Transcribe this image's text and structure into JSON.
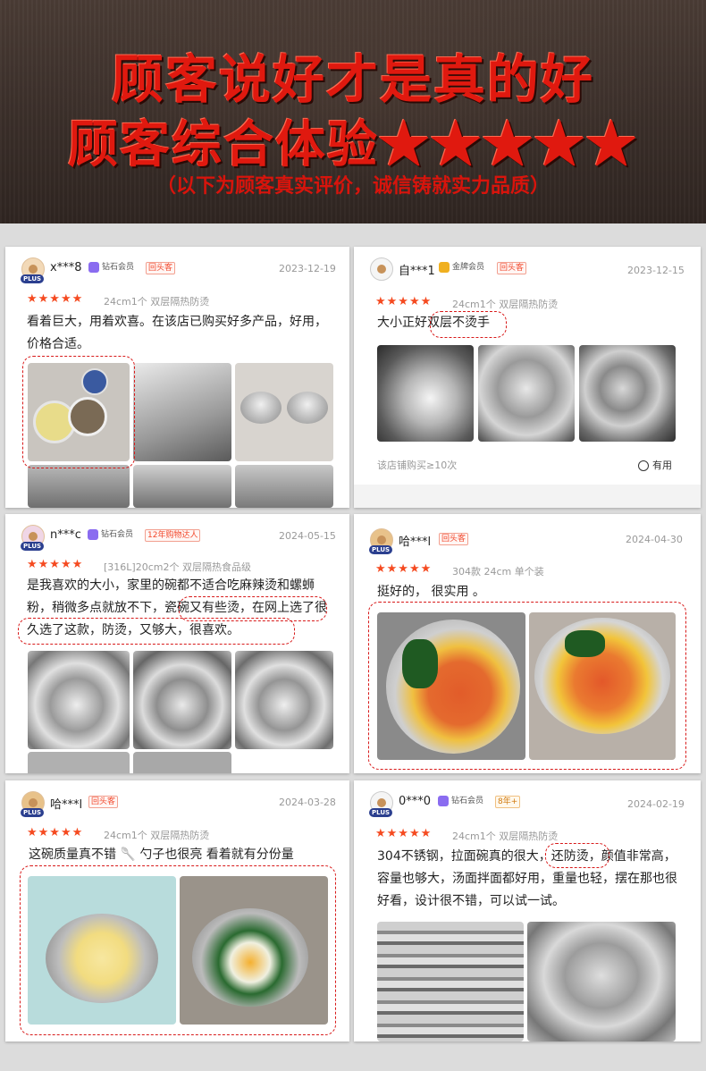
{
  "banner": {
    "line1": "顾客说好才是真的好",
    "line2": "顾客综合体验",
    "stars": "★★★★★",
    "subtitle": "（以下为顾客真实评价，诚信铸就实力品质）"
  },
  "reviews": [
    {
      "user": "x***8",
      "badge": "钻石会员",
      "tag": "回头客",
      "date": "2023-12-19",
      "rating": "★★★★★",
      "spec": "24cm1个 双层隔热防烫",
      "text": "看着巨大，用着欢喜。在该店已购买好多产品，好用，价格合适。",
      "plus": "PLUS"
    },
    {
      "user": "自***1",
      "badge": "金牌会员",
      "tag": "回头客",
      "date": "2023-12-15",
      "rating": "★★★★★",
      "spec": "24cm1个 双层隔热防烫",
      "text": "大小正好双层不烫手",
      "footer": "该店铺购买≥10次",
      "useful": "有用"
    },
    {
      "user": "n***c",
      "badge": "钻石会员",
      "tag": "12年购物达人",
      "date": "2024-05-15",
      "rating": "★★★★★",
      "spec": "[316L]20cm2个 双层隔热食品级",
      "text": "是我喜欢的大小，家里的碗都不适合吃麻辣烫和螺蛳粉，稍微多点就放不下，瓷碗又有些烫，在网上选了很久选了这款，防烫，又够大，很喜欢。",
      "plus": "PLUS"
    },
    {
      "user": "哈***l",
      "tag": "回头客",
      "date": "2024-04-30",
      "rating": "★★★★★",
      "spec": "304款 24cm 单个装",
      "text": "挺好的， 很实用 。",
      "plus": "PLUS"
    },
    {
      "user": "哈***l",
      "tag": "回头客",
      "date": "2024-03-28",
      "rating": "★★★★★",
      "spec": "24cm1个 双层隔热防烫",
      "text": "这碗质量真不错 🥄 勺子也很亮 看着就有分份量",
      "plus": "PLUS"
    },
    {
      "user": "0***0",
      "badge": "钻石会员",
      "tag": "8年+",
      "date": "2024-02-19",
      "rating": "★★★★★",
      "spec": "24cm1个 双层隔热防烫",
      "text": "304不锈钢，拉面碗真的很大，还防烫，颜值非常高，容量也够大，汤面拌面都好用，重量也轻，摆在那也很好看，设计很不错，可以试一试。",
      "plus": "PLUS"
    }
  ]
}
